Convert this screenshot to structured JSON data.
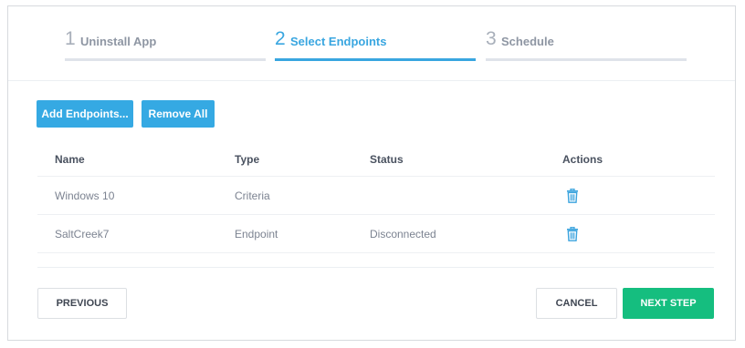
{
  "stepper": {
    "steps": [
      {
        "number": "1",
        "label": "Uninstall App",
        "state": "inactive"
      },
      {
        "number": "2",
        "label": "Select Endpoints",
        "state": "active"
      },
      {
        "number": "3",
        "label": "Schedule",
        "state": "inactive"
      }
    ]
  },
  "toolbar": {
    "add_endpoints_label": "Add Endpoints...",
    "remove_all_label": "Remove All"
  },
  "table": {
    "columns": [
      "Name",
      "Type",
      "Status",
      "Actions"
    ],
    "rows": [
      {
        "name": "Windows 10",
        "type": "Criteria",
        "status": "",
        "action_icon": "trash-icon"
      },
      {
        "name": "SaltCreek7",
        "type": "Endpoint",
        "status": "Disconnected",
        "action_icon": "trash-icon"
      }
    ]
  },
  "footer": {
    "previous_label": "PREVIOUS",
    "cancel_label": "CANCEL",
    "next_label": "NEXT STEP"
  },
  "colors": {
    "accent": "#35a9e3",
    "primary_action": "#15be7f",
    "inactive_step": "#a8afba"
  }
}
